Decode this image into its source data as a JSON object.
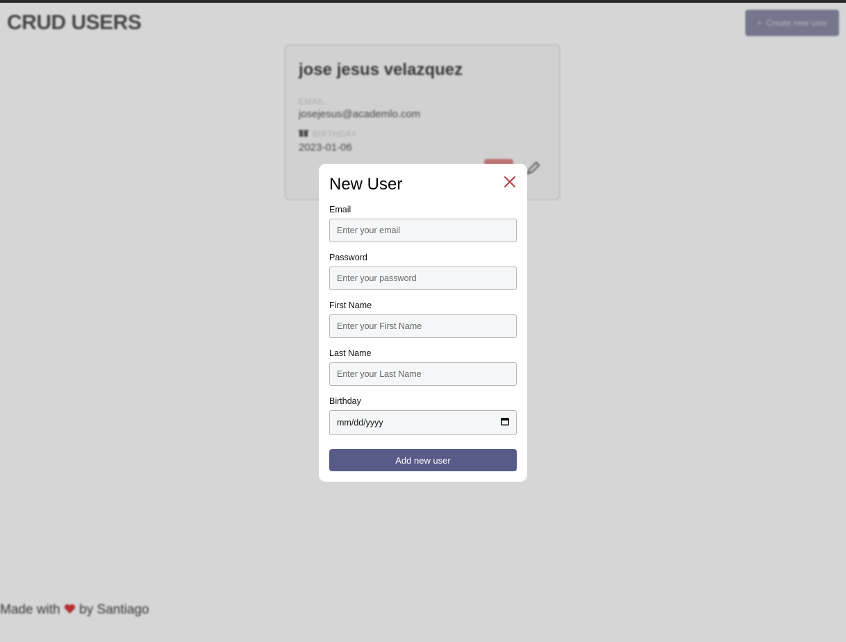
{
  "header": {
    "title": "CRUD USERS",
    "create_button_label": "Create new user",
    "create_button_icon": "plus-icon"
  },
  "user_card": {
    "name": "jose jesus velazquez",
    "email_label": "EMAIL",
    "email": "josejesus@academlo.com",
    "birthday_label": "BIRTHDAY",
    "birthday_icon": "gift-icon",
    "birthday": "2023-01-06"
  },
  "footer": {
    "text_before": "Made with",
    "heart_icon": "heart-icon",
    "text_after": "by Santiago"
  },
  "modal": {
    "title": "New User",
    "fields": [
      {
        "label": "Email",
        "placeholder": "Enter your email"
      },
      {
        "label": "Password",
        "placeholder": "Enter your password"
      },
      {
        "label": "First Name",
        "placeholder": "Enter your First Name"
      },
      {
        "label": "Last Name",
        "placeholder": "Enter your Last Name"
      }
    ],
    "birthday_label": "Birthday",
    "birthday_placeholder": "mm/dd/yyyy",
    "submit_label": "Add new user"
  },
  "colors": {
    "accent": "#585a87",
    "close": "#b03a45",
    "heart": "#d9363e"
  }
}
